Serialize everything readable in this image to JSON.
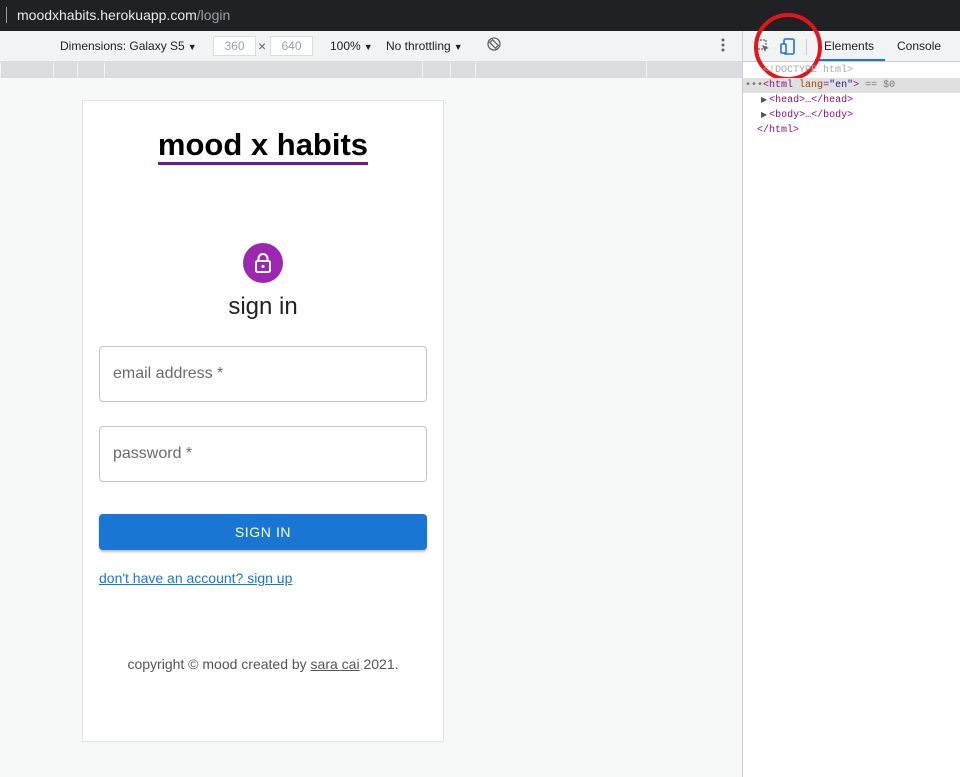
{
  "browser": {
    "url_host": "moodxhabits.herokuapp.com",
    "url_path": "/login"
  },
  "device_toolbar": {
    "dimensions_label": "Dimensions: Galaxy S5",
    "width_value": "360",
    "height_value": "640",
    "times": "×",
    "zoom": "100%",
    "throttling": "No throttling",
    "dropdown_arrow": "▼"
  },
  "app": {
    "title": "mood x habits",
    "heading": "sign in",
    "email_placeholder": "email address *",
    "password_placeholder": "password *",
    "signin_button": "SIGN IN",
    "signup_link": "don't have an account? sign up",
    "copyright_prefix": "copyright © mood created by",
    "author_link": "sara cai",
    "copyright_suffix": "2021."
  },
  "devtools": {
    "tabs": [
      "Elements",
      "Console"
    ],
    "dom": {
      "doctype": "<!DOCTYPE html>",
      "ellipsis": "•••",
      "html_open_tag": "<html",
      "html_attr_name": "lang",
      "html_attr_value": "\"en\"",
      "html_close_bracket": ">",
      "selected_marker": "== $0",
      "head_line": "<head>…</head>",
      "body_line": "<body>…</body>",
      "html_close": "</html>"
    }
  },
  "colors": {
    "title_underline": "#6a1b9a",
    "lock_avatar": "#9c27b0",
    "primary": "#1976d2",
    "annotation_circle": "#e0161b"
  },
  "icons": [
    "lock-icon",
    "rotate-icon",
    "more-vert-icon",
    "inspect-icon",
    "device-toggle-icon"
  ]
}
